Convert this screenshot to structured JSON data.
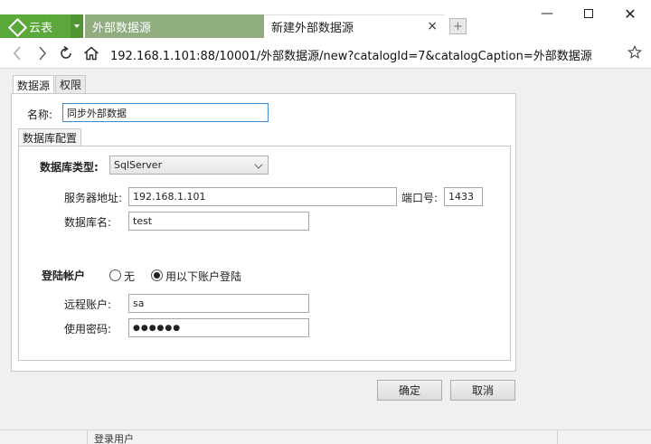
{
  "app": {
    "name": "云表",
    "accent": "#5aa83a"
  },
  "tabs": [
    {
      "label": "外部数据源",
      "active": false
    },
    {
      "label": "新建外部数据源",
      "active": true,
      "close": "×"
    }
  ],
  "newtab_symbol": "+",
  "window": {
    "minimize": "—",
    "close": "✕"
  },
  "address": {
    "url": "192.168.1.101:88/10001/外部数据源/new?catalogId=7&catalogCaption=外部数据源"
  },
  "page_tabs": [
    "数据源",
    "权限"
  ],
  "form": {
    "name_label": "名称:",
    "name_value": "同步外部数据",
    "db_config_tab": "数据库配置",
    "db_type_label": "数据库类型:",
    "db_type_value": "SqlServer",
    "server_label": "服务器地址:",
    "server_value": "192.168.1.101",
    "port_label": "端口号:",
    "port_value": "1433",
    "dbname_label": "数据库名:",
    "dbname_value": "test",
    "login_label": "登陆帐户",
    "radio_none": "无",
    "radio_account": "用以下账户登陆",
    "remote_user_label": "远程账户:",
    "remote_user_value": "sa",
    "password_label": "使用密码:",
    "password_value": "●●●●●●"
  },
  "buttons": {
    "ok": "确定",
    "cancel": "取消"
  },
  "status": {
    "text": "登录用户"
  }
}
